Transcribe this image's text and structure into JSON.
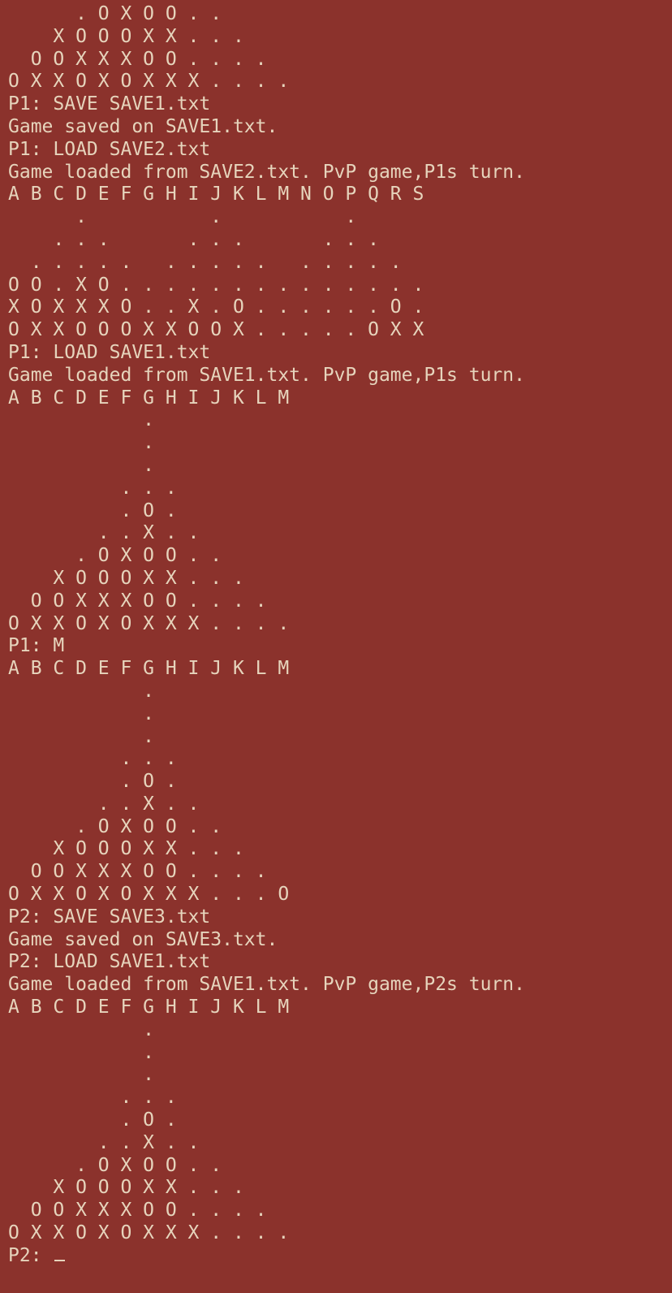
{
  "terminal": {
    "lines": [
      "      . O X O O . .",
      "    X O O O X X . . .",
      "  O O X X X O O . . . .",
      "O X X O X O X X X . . . .",
      "P1: SAVE SAVE1.txt",
      "Game saved on SAVE1.txt.",
      "P1: LOAD SAVE2.txt",
      "Game loaded from SAVE2.txt. PvP game,P1s turn.",
      "A B C D E F G H I J K L M N O P Q R S",
      "      .           .           .",
      "    . . .       . . .       . . .",
      "  . . . . .   . . . . .   . . . . .",
      "O O . X O . . . . . . . . . . . . . .",
      "X O X X X O . . X . O . . . . . . O .",
      "O X X O O O X X O O X . . . . . O X X",
      "P1: LOAD SAVE1.txt",
      "Game loaded from SAVE1.txt. PvP game,P1s turn.",
      "A B C D E F G H I J K L M",
      "            .",
      "            .",
      "            .",
      "          . . .",
      "          . O .",
      "        . . X . .",
      "      . O X O O . .",
      "    X O O O X X . . .",
      "  O O X X X O O . . . .",
      "O X X O X O X X X . . . .",
      "P1: M",
      "A B C D E F G H I J K L M",
      "            .",
      "            .",
      "            .",
      "          . . .",
      "          . O .",
      "        . . X . .",
      "      . O X O O . .",
      "    X O O O X X . . .",
      "  O O X X X O O . . . .",
      "O X X O X O X X X . . . O",
      "P2: SAVE SAVE3.txt",
      "Game saved on SAVE3.txt.",
      "P2: LOAD SAVE1.txt",
      "Game loaded from SAVE1.txt. PvP game,P2s turn.",
      "A B C D E F G H I J K L M",
      "            .",
      "            .",
      "            .",
      "          . . .",
      "          . O .",
      "        . . X . .",
      "      . O X O O . .",
      "    X O O O X X . . .",
      "  O O X X X O O . . . .",
      "O X X O X O X X X . . . ."
    ],
    "prompt": "P2: "
  }
}
